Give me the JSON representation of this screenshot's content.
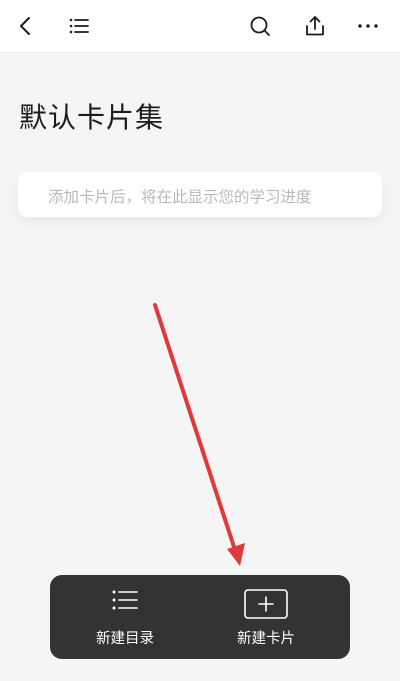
{
  "header": {
    "back_icon": "back-chevron-icon",
    "toc_icon": "list-icon",
    "search_icon": "search-icon",
    "share_icon": "share-icon",
    "more_icon": "more-dots-icon"
  },
  "main": {
    "title": "默认卡片集",
    "progress_hint": "添加卡片后，将在此显示您的学习进度"
  },
  "action_bar": {
    "new_toc_label": "新建目录",
    "new_card_label": "新建卡片",
    "new_toc_icon": "list-icon",
    "new_card_icon": "add-card-icon"
  },
  "annotation": {
    "arrow_color": "#e0393a",
    "arrow_icon": "annotation-arrow"
  }
}
